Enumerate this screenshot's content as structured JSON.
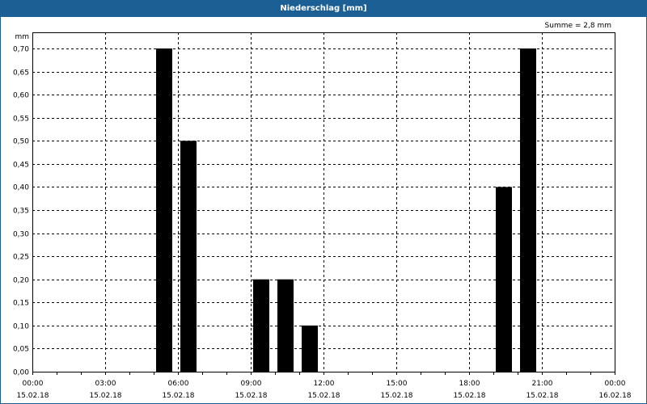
{
  "window": {
    "title": "Niederschlag [mm]"
  },
  "chart_data": {
    "type": "bar",
    "title": "Niederschlag [mm]",
    "ylabel": "mm",
    "annotation": "Summe = 2,8 mm",
    "ylim": [
      0,
      0.735
    ],
    "yticks": [
      "0,00",
      "0,05",
      "0,10",
      "0,15",
      "0,20",
      "0,25",
      "0,30",
      "0,35",
      "0,40",
      "0,45",
      "0,50",
      "0,55",
      "0,60",
      "0,65",
      "0,70"
    ],
    "xlim_hours": [
      0,
      24
    ],
    "xticks": [
      {
        "time": "00:00",
        "date": "15.02.18"
      },
      {
        "time": "03:00",
        "date": "15.02.18"
      },
      {
        "time": "06:00",
        "date": "15.02.18"
      },
      {
        "time": "09:00",
        "date": "15.02.18"
      },
      {
        "time": "12:00",
        "date": "15.02.18"
      },
      {
        "time": "15:00",
        "date": "15.02.18"
      },
      {
        "time": "18:00",
        "date": "15.02.18"
      },
      {
        "time": "21:00",
        "date": "15.02.18"
      },
      {
        "time": "00:00",
        "date": "16.02.18"
      }
    ],
    "bars": [
      {
        "hour_start": 5,
        "value": 0.7
      },
      {
        "hour_start": 6,
        "value": 0.5
      },
      {
        "hour_start": 9,
        "value": 0.2
      },
      {
        "hour_start": 10,
        "value": 0.2
      },
      {
        "hour_start": 11,
        "value": 0.1
      },
      {
        "hour_start": 19,
        "value": 0.4
      },
      {
        "hour_start": 20,
        "value": 0.7
      }
    ],
    "grid": true,
    "bar_color": "#000000"
  }
}
